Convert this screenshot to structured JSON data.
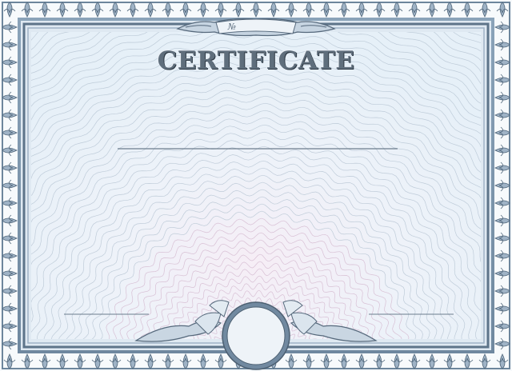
{
  "certificate": {
    "title": "CERTIFICATE",
    "number_sign": "№"
  },
  "colors": {
    "border_dark": "#5d7489",
    "border_light": "#9fb3c6",
    "panel": "#eef4fa",
    "guilloche": "#b9c6d3",
    "guilloche_center": "#d6b8cf"
  },
  "icons": [
    "ornamental-border",
    "banner-ribbon",
    "seal-medallion",
    "guilloche-background"
  ]
}
